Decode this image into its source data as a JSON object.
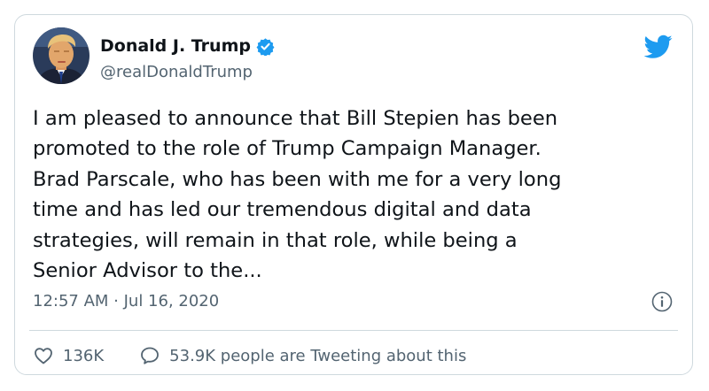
{
  "tweet": {
    "author": {
      "display_name": "Donald J. Trump",
      "handle": "@realDonaldTrump",
      "verified": true,
      "avatar_icon": "profile-photo"
    },
    "text_lines": [
      "I am pleased to announce that Bill Stepien has been",
      "promoted to the role of Trump Campaign Manager.",
      "Brad Parscale, who has been with me for a very long",
      "time and has led our tremendous digital and data",
      "strategies, will remain in that role, while being a",
      "Senior Advisor to the..."
    ],
    "timestamp": "12:57 AM · Jul 16, 2020",
    "likes": "136K",
    "talking": "53.9K people are Tweeting about this"
  },
  "colors": {
    "brand_blue": "#1d9bf0",
    "text_primary": "#0f1419",
    "text_secondary": "#536471",
    "border": "#cfd9de"
  },
  "icons": {
    "brand": "twitter-bird-icon",
    "verified": "verified-badge-icon",
    "info": "info-icon",
    "like": "heart-icon",
    "reply": "speech-bubble-icon"
  }
}
